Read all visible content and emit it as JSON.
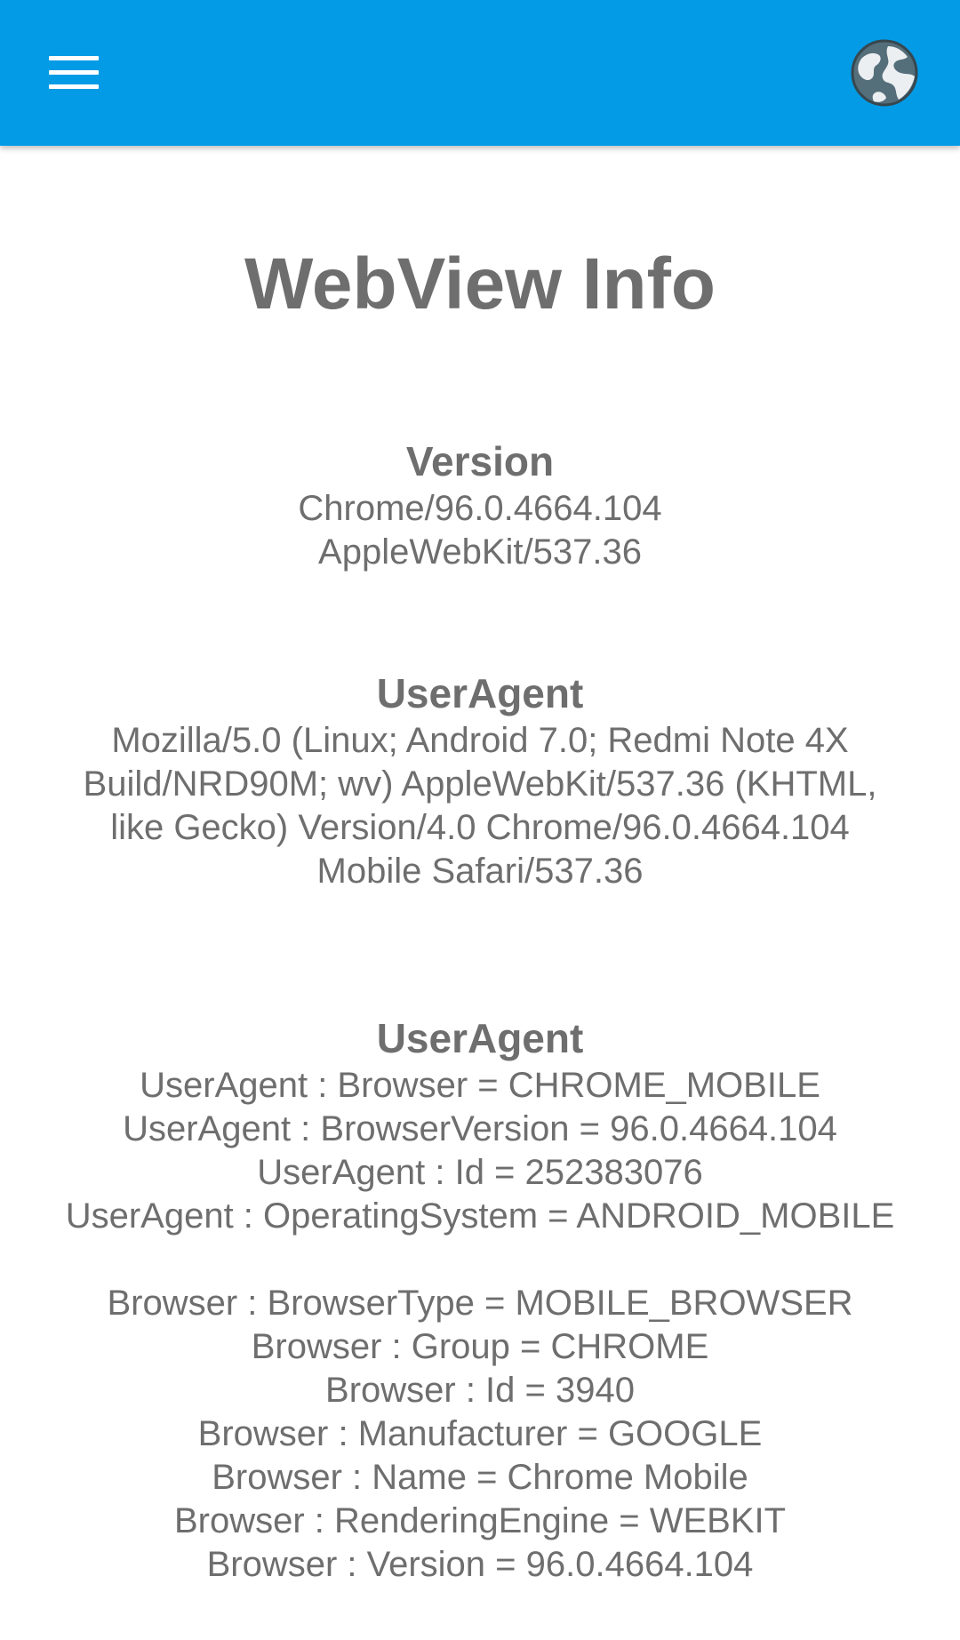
{
  "app_bar": {
    "menu_icon": "hamburger-menu-icon",
    "globe_icon": "globe-icon",
    "background_color": "#039be5"
  },
  "page": {
    "title": "WebView Info"
  },
  "sections": {
    "version": {
      "heading": "Version",
      "lines": [
        "Chrome/96.0.4664.104",
        "AppleWebKit/537.36"
      ]
    },
    "user_agent_string": {
      "heading": "UserAgent",
      "lines": [
        "Mozilla/5.0 (Linux; Android 7.0; Redmi Note 4X",
        "Build/NRD90M; wv) AppleWebKit/537.36 (KHTML,",
        "like Gecko) Version/4.0 Chrome/96.0.4664.104",
        "Mobile Safari/537.36"
      ]
    },
    "user_agent_details": {
      "heading": "UserAgent",
      "user_agent_lines": [
        "UserAgent : Browser = CHROME_MOBILE",
        "UserAgent : BrowserVersion = 96.0.4664.104",
        "UserAgent : Id = 252383076",
        "UserAgent : OperatingSystem = ANDROID_MOBILE"
      ],
      "browser_lines": [
        "Browser : BrowserType = MOBILE_BROWSER",
        "Browser : Group = CHROME",
        "Browser : Id = 3940",
        "Browser : Manufacturer = GOOGLE",
        "Browser : Name = Chrome Mobile",
        "Browser : RenderingEngine = WEBKIT",
        "Browser : Version = 96.0.4664.104"
      ]
    }
  }
}
